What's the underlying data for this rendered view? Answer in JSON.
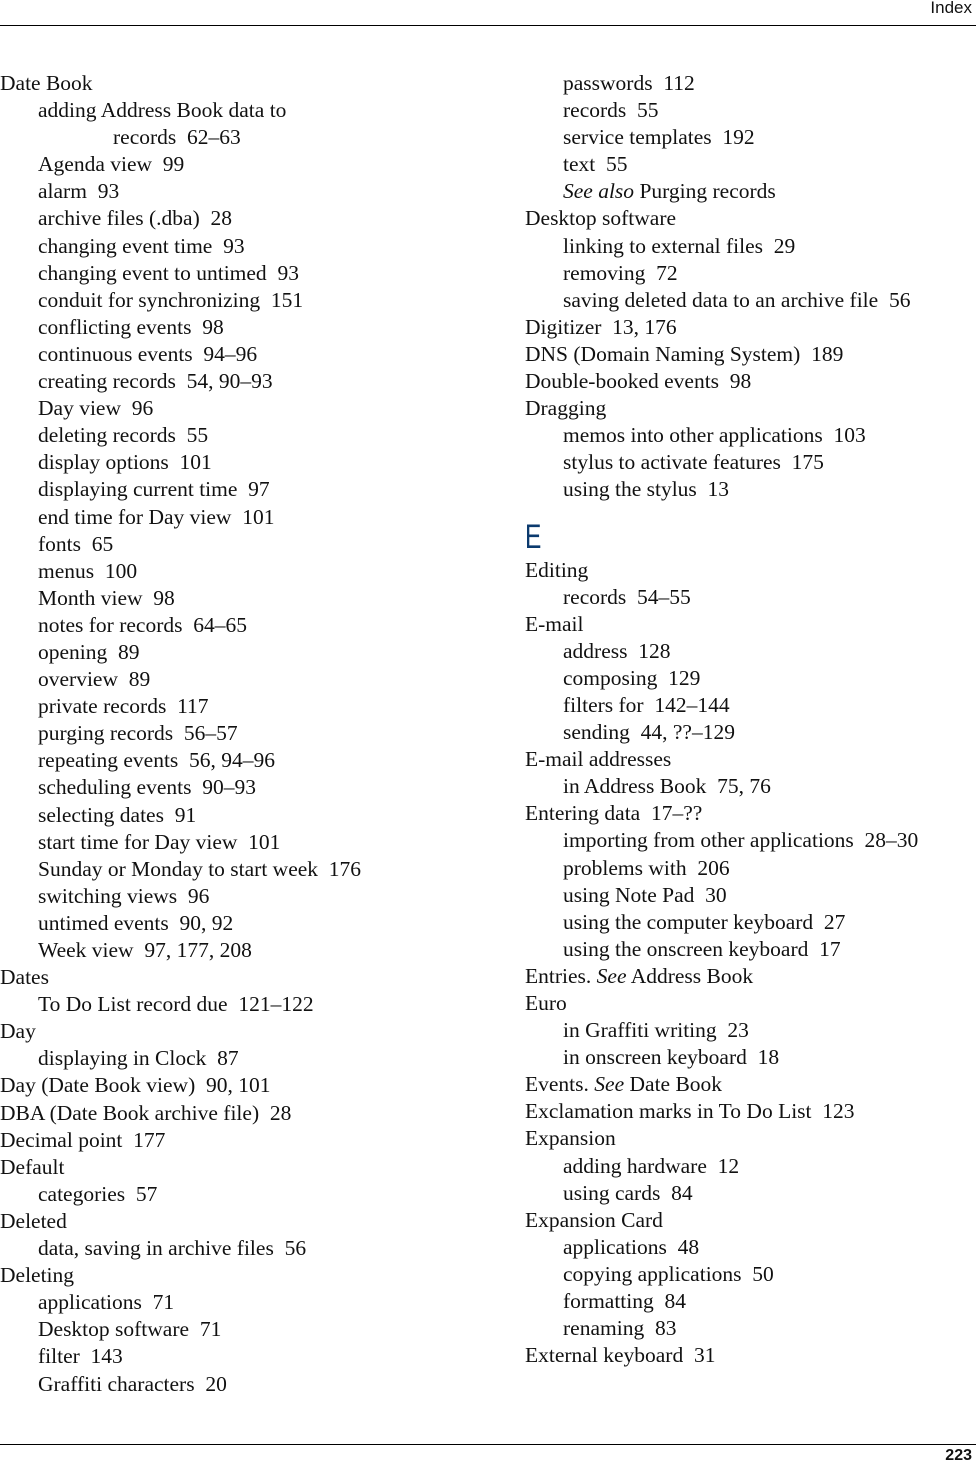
{
  "header": {
    "title": "Index"
  },
  "footer": {
    "page_number": "223"
  },
  "accent_color": "#0b3a6e",
  "left_column": [
    {
      "level": 0,
      "term": "Date Book",
      "pages": ""
    },
    {
      "level": 1,
      "term": "adding Address Book data to",
      "pages": ""
    },
    {
      "level": 2,
      "term": "records",
      "pages": "62–63"
    },
    {
      "level": 1,
      "term": "Agenda view",
      "pages": "99"
    },
    {
      "level": 1,
      "term": "alarm",
      "pages": "93"
    },
    {
      "level": 1,
      "term": "archive files (.dba)",
      "pages": "28"
    },
    {
      "level": 1,
      "term": "changing event time",
      "pages": "93"
    },
    {
      "level": 1,
      "term": "changing event to untimed",
      "pages": "93"
    },
    {
      "level": 1,
      "term": "conduit for synchronizing",
      "pages": "151"
    },
    {
      "level": 1,
      "term": "conflicting events",
      "pages": "98"
    },
    {
      "level": 1,
      "term": "continuous events",
      "pages": "94–96"
    },
    {
      "level": 1,
      "term": "creating records",
      "pages": "54, 90–93"
    },
    {
      "level": 1,
      "term": "Day view",
      "pages": "96"
    },
    {
      "level": 1,
      "term": "deleting records",
      "pages": "55"
    },
    {
      "level": 1,
      "term": "display options",
      "pages": "101"
    },
    {
      "level": 1,
      "term": "displaying current time",
      "pages": "97"
    },
    {
      "level": 1,
      "term": "end time for Day view",
      "pages": "101"
    },
    {
      "level": 1,
      "term": "fonts",
      "pages": "65"
    },
    {
      "level": 1,
      "term": "menus",
      "pages": "100"
    },
    {
      "level": 1,
      "term": "Month view",
      "pages": "98"
    },
    {
      "level": 1,
      "term": "notes for records",
      "pages": "64–65"
    },
    {
      "level": 1,
      "term": "opening",
      "pages": "89"
    },
    {
      "level": 1,
      "term": "overview",
      "pages": "89"
    },
    {
      "level": 1,
      "term": "private records",
      "pages": "117"
    },
    {
      "level": 1,
      "term": "purging records",
      "pages": "56–57"
    },
    {
      "level": 1,
      "term": "repeating events",
      "pages": "56, 94–96"
    },
    {
      "level": 1,
      "term": "scheduling events",
      "pages": "90–93"
    },
    {
      "level": 1,
      "term": "selecting dates",
      "pages": "91"
    },
    {
      "level": 1,
      "term": "start time for Day view",
      "pages": "101"
    },
    {
      "level": 1,
      "term": "Sunday or Monday to start week",
      "pages": "176"
    },
    {
      "level": 1,
      "term": "switching views",
      "pages": "96"
    },
    {
      "level": 1,
      "term": "untimed events",
      "pages": "90, 92"
    },
    {
      "level": 1,
      "term": "Week view",
      "pages": "97, 177, 208"
    },
    {
      "level": 0,
      "term": "Dates",
      "pages": ""
    },
    {
      "level": 1,
      "term": "To Do List record due",
      "pages": "121–122"
    },
    {
      "level": 0,
      "term": "Day",
      "pages": ""
    },
    {
      "level": 1,
      "term": "displaying in Clock",
      "pages": "87"
    },
    {
      "level": 0,
      "term": "Day (Date Book view)",
      "pages": "90, 101"
    },
    {
      "level": 0,
      "term": "DBA (Date Book archive file)",
      "pages": "28"
    },
    {
      "level": 0,
      "term": "Decimal point",
      "pages": "177"
    },
    {
      "level": 0,
      "term": "Default",
      "pages": ""
    },
    {
      "level": 1,
      "term": "categories",
      "pages": "57"
    },
    {
      "level": 0,
      "term": "Deleted",
      "pages": ""
    },
    {
      "level": 1,
      "term": "data, saving in archive files",
      "pages": "56"
    },
    {
      "level": 0,
      "term": "Deleting",
      "pages": ""
    },
    {
      "level": 1,
      "term": "applications",
      "pages": "71"
    },
    {
      "level": 1,
      "term": "Desktop software",
      "pages": "71"
    },
    {
      "level": 1,
      "term": "filter",
      "pages": "143"
    },
    {
      "level": 1,
      "term": "Graffiti characters",
      "pages": "20"
    }
  ],
  "right_column_d": [
    {
      "level": 1,
      "term": "passwords",
      "pages": "112"
    },
    {
      "level": 1,
      "term": "records",
      "pages": "55"
    },
    {
      "level": 1,
      "term": "service templates",
      "pages": "192"
    },
    {
      "level": 1,
      "term": "text",
      "pages": "55"
    },
    {
      "level": 1,
      "see": "See also",
      "term": " Purging records",
      "pages": ""
    },
    {
      "level": 0,
      "term": "Desktop software",
      "pages": ""
    },
    {
      "level": 1,
      "term": "linking to external files",
      "pages": "29"
    },
    {
      "level": 1,
      "term": "removing",
      "pages": "72"
    },
    {
      "level": 1,
      "term": "saving deleted data to an archive file",
      "pages": "56"
    },
    {
      "level": 0,
      "term": "Digitizer",
      "pages": "13, 176"
    },
    {
      "level": 0,
      "term": "DNS (Domain Naming System)",
      "pages": "189"
    },
    {
      "level": 0,
      "term": "Double-booked events",
      "pages": "98"
    },
    {
      "level": 0,
      "term": "Dragging",
      "pages": ""
    },
    {
      "level": 1,
      "term": "memos into other applications",
      "pages": "103"
    },
    {
      "level": 1,
      "term": "stylus to activate features",
      "pages": "175"
    },
    {
      "level": 1,
      "term": "using the stylus",
      "pages": "13"
    }
  ],
  "section_e": {
    "letter": "E",
    "entries": [
      {
        "level": 0,
        "term": "Editing",
        "pages": ""
      },
      {
        "level": 1,
        "term": "records",
        "pages": "54–55"
      },
      {
        "level": 0,
        "term": "E-mail",
        "pages": ""
      },
      {
        "level": 1,
        "term": "address",
        "pages": "128"
      },
      {
        "level": 1,
        "term": "composing",
        "pages": "129"
      },
      {
        "level": 1,
        "term": "filters for",
        "pages": "142–144"
      },
      {
        "level": 1,
        "term": "sending",
        "pages": "44, ??–129"
      },
      {
        "level": 0,
        "term": "E-mail addresses",
        "pages": ""
      },
      {
        "level": 1,
        "term": "in Address Book",
        "pages": "75, 76"
      },
      {
        "level": 0,
        "term": "Entering data",
        "pages": "17–??"
      },
      {
        "level": 1,
        "term": "importing from other applications",
        "pages": "28–30"
      },
      {
        "level": 1,
        "term": "problems with",
        "pages": "206"
      },
      {
        "level": 1,
        "term": "using Note Pad",
        "pages": "30"
      },
      {
        "level": 1,
        "term": "using the computer keyboard",
        "pages": "27"
      },
      {
        "level": 1,
        "term": "using the onscreen keyboard",
        "pages": "17"
      },
      {
        "level": 0,
        "term": "Entries. ",
        "see": "See",
        "after": " Address Book",
        "pages": ""
      },
      {
        "level": 0,
        "term": "Euro",
        "pages": ""
      },
      {
        "level": 1,
        "term": "in Graffiti writing",
        "pages": "23"
      },
      {
        "level": 1,
        "term": "in onscreen keyboard",
        "pages": "18"
      },
      {
        "level": 0,
        "term": "Events. ",
        "see": "See",
        "after": " Date Book",
        "pages": ""
      },
      {
        "level": 0,
        "term": "Exclamation marks in To Do List",
        "pages": "123"
      },
      {
        "level": 0,
        "term": "Expansion",
        "pages": ""
      },
      {
        "level": 1,
        "term": "adding hardware",
        "pages": "12"
      },
      {
        "level": 1,
        "term": "using cards",
        "pages": "84"
      },
      {
        "level": 0,
        "term": "Expansion Card",
        "pages": ""
      },
      {
        "level": 1,
        "term": "applications",
        "pages": "48"
      },
      {
        "level": 1,
        "term": "copying applications",
        "pages": "50"
      },
      {
        "level": 1,
        "term": "formatting",
        "pages": "84"
      },
      {
        "level": 1,
        "term": "renaming",
        "pages": "83"
      },
      {
        "level": 0,
        "term": "External keyboard",
        "pages": "31"
      }
    ]
  }
}
